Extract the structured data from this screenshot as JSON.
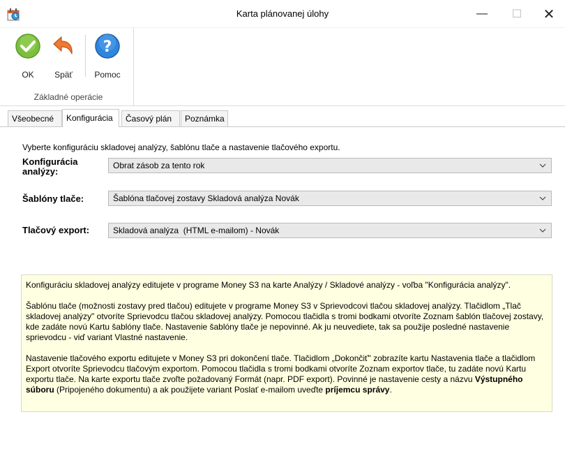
{
  "window": {
    "title": "Karta plánovanej úlohy",
    "icons": {
      "app": "calendar-app-icon",
      "minimize": "minimize-icon",
      "maximize": "maximize-icon",
      "close": "close-icon"
    }
  },
  "ribbon": {
    "buttons": {
      "ok": {
        "label": "OK",
        "icon": "check-icon",
        "color": "#6db33f"
      },
      "back": {
        "label": "Späť",
        "icon": "undo-arrow-icon",
        "color": "#e8712b"
      },
      "help": {
        "label": "Pomoc",
        "icon": "help-question-icon",
        "color": "#2a7fd4"
      }
    },
    "group_label": "Základné operácie"
  },
  "tabs": [
    {
      "label": "Všeobecné",
      "active": false
    },
    {
      "label": "Konfigurácia",
      "active": true
    },
    {
      "label": "Časový plán",
      "active": false
    },
    {
      "label": "Poznámka",
      "active": false
    }
  ],
  "content": {
    "intro": "Vyberte konfiguráciu skladovej analýzy, šablónu tlače a nastavenie tlačového exportu.",
    "fields": {
      "analyza": {
        "label_line1": "Konfigurácia",
        "label_line2": "analýzy:",
        "value": "Obrat zásob za tento rok"
      },
      "sablony": {
        "label": "Šablóny tlače:",
        "value": "Šablóna tlačovej zostavy Skladová analýza Novák"
      },
      "export": {
        "label": "Tlačový export:",
        "value": "Skladová analýza  (HTML e-mailom) - Novák"
      }
    }
  },
  "help": {
    "p1": "Konfiguráciu skladovej analýzy editujete v programe Money S3 na karte Analýzy / Skladové analýzy - voľba \"Konfigurácia analýzy\".",
    "p2": "Šablónu tlače (možnosti zostavy pred tlačou) editujete v programe Money S3 v Sprievodcovi tlačou skladovej analýzy. Tlačidlom „Tlač skladovej analýzy\" otvoríte Sprievodcu tlačou skladovej analýzy. Pomocou tlačidla s tromi bodkami otvoríte Zoznam šablón tlačovej zostavy, kde zadáte novú Kartu šablóny tlače. Nastavenie šablóny tlače je nepovinné. Ak ju neuvediete, tak sa použije posledné nastavenie sprievodcu - viď variant Vlastné nastavenie.",
    "p3_a": "Nastavenie tlačového exportu editujete v Money S3 pri dokončení tlače. Tlačidlom „Dokončiť\" zobrazíte kartu Nastavenia tlače a tlačidlom Export otvoríte Sprievodcu tlačovým exportom. Pomocou tlačidla s tromi bodkami otvoríte Zoznam exportov tlače, tu zadáte novú Kartu exportu tlače. Na karte exportu tlače zvoľte požadovaný Formát (napr. PDF export). Povinné je nastavenie cesty a názvu ",
    "p3_b": "Výstupného súboru",
    "p3_c": " (Pripojeného dokumentu) a ak použijete variant Poslať e-mailom uveďte ",
    "p3_d": "príjemcu správy",
    "p3_e": "."
  },
  "colors": {
    "help_bg": "#ffffe1",
    "select_bg": "#e9e9e9"
  }
}
